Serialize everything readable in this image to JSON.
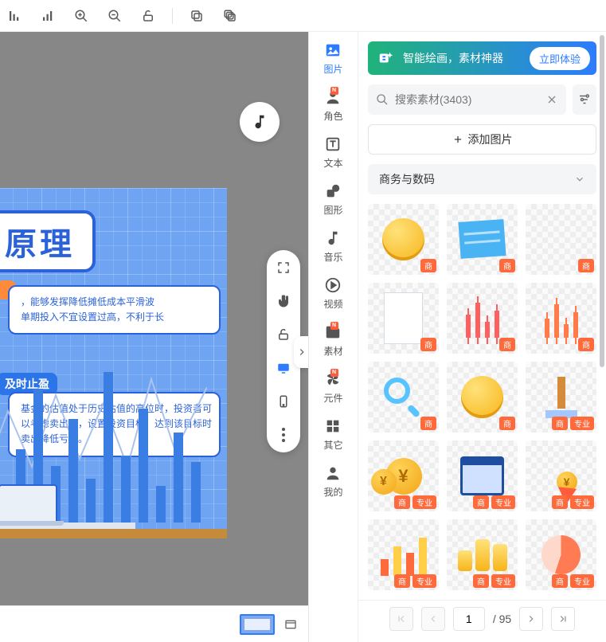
{
  "toolbar": {
    "icons": [
      "bar-down",
      "bar-up",
      "zoom-in",
      "zoom-out",
      "unlock",
      "copy",
      "copy-stack"
    ]
  },
  "canvas": {
    "slide_title": "原理",
    "bubble1": [
      "，能够发挥降低摊低成本平滑波",
      "单期投入不宜设置过高，不利于长"
    ],
    "sub_pill": "及时止盈",
    "bubble2": [
      "基金的估值处于历史估值的高位时，投资者可",
      "以考虑卖出它，设置投资目标，达到该目标时",
      "卖出降低亏损。"
    ]
  },
  "nav": {
    "items": [
      {
        "key": "image",
        "label": "图片",
        "badge": false,
        "active": true
      },
      {
        "key": "role",
        "label": "角色",
        "badge": true,
        "active": false
      },
      {
        "key": "text",
        "label": "文本",
        "badge": false,
        "active": false
      },
      {
        "key": "shape",
        "label": "图形",
        "badge": false,
        "active": false
      },
      {
        "key": "music",
        "label": "音乐",
        "badge": false,
        "active": false
      },
      {
        "key": "video",
        "label": "视频",
        "badge": false,
        "active": false
      },
      {
        "key": "asset",
        "label": "素材",
        "badge": true,
        "active": false
      },
      {
        "key": "component",
        "label": "元件",
        "badge": true,
        "active": false
      },
      {
        "key": "other",
        "label": "其它",
        "badge": false,
        "active": false
      },
      {
        "key": "mine",
        "label": "我的",
        "badge": false,
        "active": false
      }
    ],
    "badge_text": "N"
  },
  "panel": {
    "ai_text": "智能绘画，素材神器",
    "ai_cta": "立即体验",
    "search_placeholder": "搜索素材(3403)",
    "add_image": "添加图片",
    "category": "商务与数码",
    "tag_biz": "商",
    "tag_pro": "专业",
    "pager": {
      "page": "1",
      "total_label": "/ 95"
    }
  }
}
